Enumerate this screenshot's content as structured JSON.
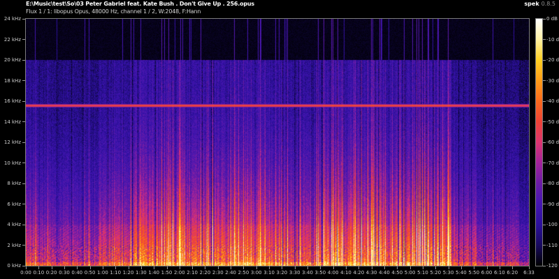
{
  "app": {
    "name": "spek",
    "version": "0.8.5"
  },
  "header": {
    "file_path": "E:\\Music\\test\\So\\03 Peter Gabriel feat. Kate Bush . Don't Give Up . 256.opus",
    "stream_info": "Flux 1 / 1: libopus Opus, 48000 Hz, channel 1 / 2, W:2048, F:Hann"
  },
  "chart_data": {
    "type": "heatmap",
    "title": "audio spectrogram",
    "x_axis": {
      "label": "time",
      "unit": "min:sec",
      "duration_seconds": 393,
      "tick_interval_seconds": 10,
      "tick_seconds": [
        0,
        10,
        20,
        30,
        40,
        50,
        60,
        70,
        80,
        90,
        100,
        110,
        120,
        130,
        140,
        150,
        160,
        170,
        180,
        190,
        200,
        210,
        220,
        230,
        240,
        250,
        260,
        270,
        280,
        290,
        300,
        310,
        320,
        330,
        340,
        350,
        360,
        370,
        380,
        393
      ],
      "tick_labels": [
        "0:00",
        "0:10",
        "0:20",
        "0:30",
        "0:40",
        "0:50",
        "1:00",
        "1:10",
        "1:20",
        "1:30",
        "1:40",
        "1:50",
        "2:00",
        "2:10",
        "2:20",
        "2:30",
        "2:40",
        "2:50",
        "3:00",
        "3:10",
        "3:20",
        "3:30",
        "3:40",
        "3:50",
        "4:00",
        "4:10",
        "4:20",
        "4:30",
        "4:40",
        "4:50",
        "5:00",
        "5:10",
        "5:20",
        "5:30",
        "5:40",
        "5:50",
        "6:00",
        "6:10",
        "6:20",
        "6:33"
      ]
    },
    "y_axis": {
      "label": "frequency",
      "unit": "kHz",
      "min_khz": 0,
      "max_khz": 24,
      "tick_labels": [
        "24 kHz",
        "22 kHz",
        "20 kHz",
        "18 kHz",
        "16 kHz",
        "14 kHz",
        "12 kHz",
        "10 kHz",
        "8 kHz",
        "6 kHz",
        "4 kHz",
        "2 kHz",
        "0 kHz"
      ]
    },
    "color_scale": {
      "label": "dB",
      "min_db": -120,
      "max_db": 0,
      "tick_labels": [
        "0 dB",
        "-10 dB",
        "-20 dB",
        "-30 dB",
        "-40 dB",
        "-50 dB",
        "-60 dB",
        "-70 dB",
        "-80 dB",
        "-90 dB",
        "-100 dB",
        "-110 dB",
        "-120 dB"
      ],
      "palette": [
        [
          0.0,
          "#000000"
        ],
        [
          0.083,
          "#180a5e"
        ],
        [
          0.167,
          "#2c109b"
        ],
        [
          0.25,
          "#4516b2"
        ],
        [
          0.333,
          "#6b1ca6"
        ],
        [
          0.417,
          "#a4239c"
        ],
        [
          0.5,
          "#dc3570"
        ],
        [
          0.583,
          "#ee4336"
        ],
        [
          0.667,
          "#fb6a1d"
        ],
        [
          0.75,
          "#ff9c18"
        ],
        [
          0.833,
          "#ffd023"
        ],
        [
          0.917,
          "#fff2a4"
        ],
        [
          1.0,
          "#ffffff"
        ]
      ]
    },
    "features": {
      "pilot_tone_khz": 15.6,
      "content_cutoff_khz": 20,
      "segments": [
        {
          "t0": 0,
          "t1": 10,
          "level": 0.62,
          "hit_prob": 0.1
        },
        {
          "t0": 10,
          "t1": 56,
          "level": 0.5,
          "hit_prob": 0.06
        },
        {
          "t0": 56,
          "t1": 85,
          "level": 0.62,
          "hit_prob": 0.12
        },
        {
          "t0": 85,
          "t1": 190,
          "level": 0.74,
          "hit_prob": 0.22
        },
        {
          "t0": 190,
          "t1": 228,
          "level": 0.68,
          "hit_prob": 0.16
        },
        {
          "t0": 228,
          "t1": 332,
          "level": 0.78,
          "hit_prob": 0.26
        },
        {
          "t0": 332,
          "t1": 352,
          "level": 0.6,
          "hit_prob": 0.1
        },
        {
          "t0": 352,
          "t1": 385,
          "level": 0.48,
          "hit_prob": 0.06
        },
        {
          "t0": 385,
          "t1": 393,
          "level": 0.34,
          "hit_prob": 0.02
        }
      ]
    }
  }
}
